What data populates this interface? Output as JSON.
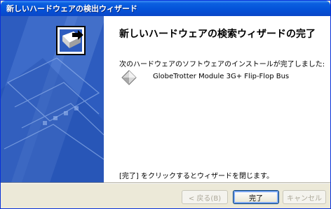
{
  "window": {
    "title": "新しいハードウェアの検出ウィザード"
  },
  "wizard": {
    "heading": "新しいハードウェアの検索ウィザードの完了",
    "description": "次のハードウェアのソフトウェアのインストールが完了しました:",
    "device_name": "GlobeTrotter Module 3G+ Flip-Flop Bus",
    "device_icon": "diamond-device-icon",
    "finish_hint": "[完了] をクリックするとウィザードを閉じます。"
  },
  "buttons": {
    "back_label": "< 戻る(B)",
    "finish_label": "完了",
    "cancel_label": "キャンセル",
    "back_enabled": false,
    "cancel_enabled": false
  },
  "colors": {
    "titlebar": "#0453d9",
    "side_panel": "#2d5cbf",
    "dialog_bg": "#ece9d8"
  }
}
